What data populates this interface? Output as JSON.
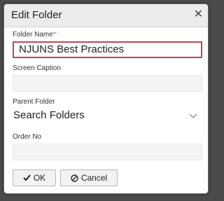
{
  "dialog": {
    "title": "Edit Folder",
    "close_icon": "close-icon"
  },
  "form": {
    "folder_name": {
      "label": "Folder Name",
      "required_mark": "*",
      "value": "NJUNS Best Practices"
    },
    "screen_caption": {
      "label": "Screen Caption",
      "value": ""
    },
    "parent_folder": {
      "label": "Parent Folder",
      "value": "Search Folders",
      "icon": "chevron-down-icon"
    },
    "order_no": {
      "label": "Order No",
      "value": ""
    }
  },
  "buttons": {
    "ok": {
      "label": "OK",
      "icon": "checkmark-icon"
    },
    "cancel": {
      "label": "Cancel",
      "icon": "cancel-icon"
    }
  },
  "colors": {
    "required": "#e53935",
    "active_border": "#c0464b",
    "backdrop": "#4b4b4b"
  }
}
